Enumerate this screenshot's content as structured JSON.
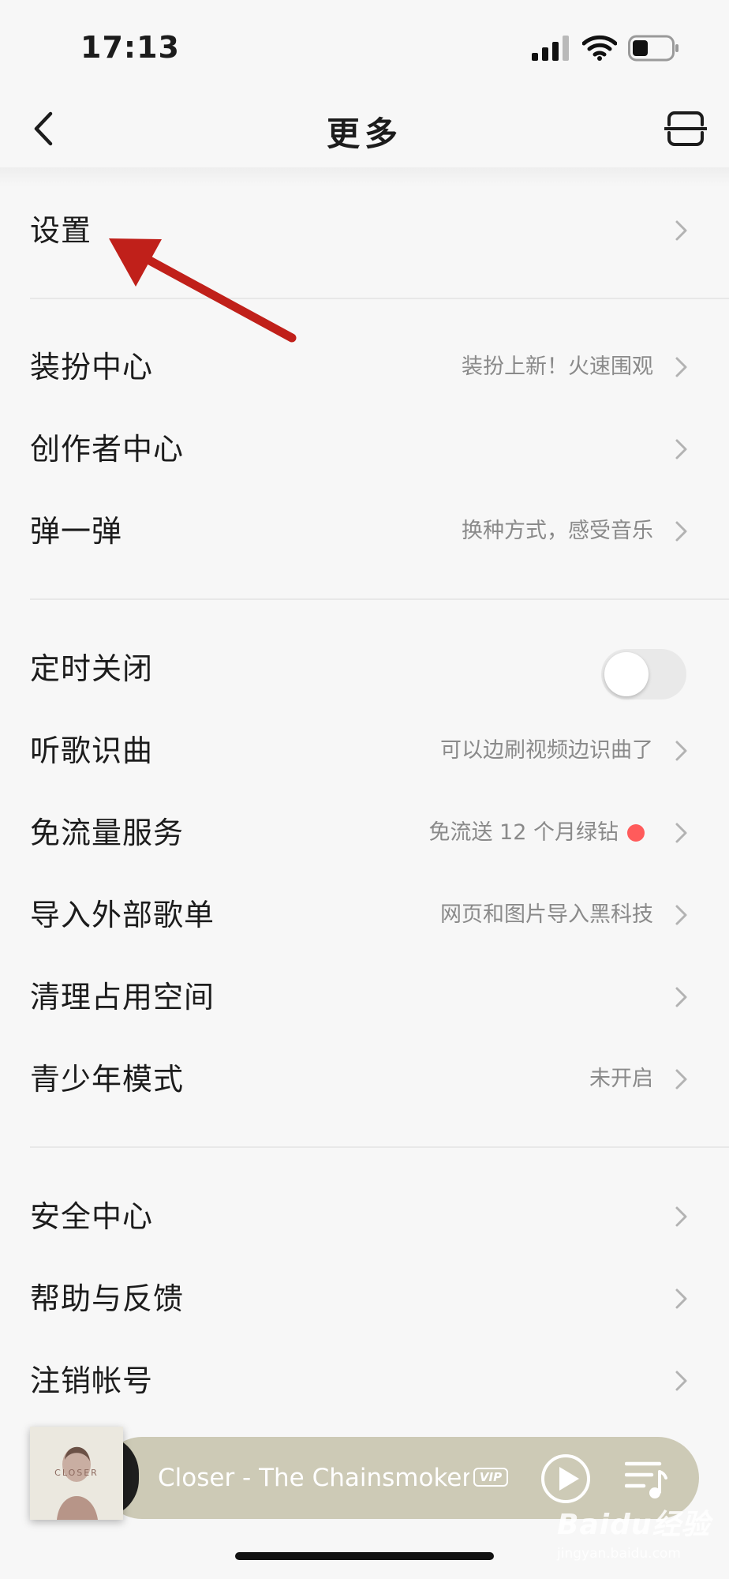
{
  "status_bar": {
    "time": "17:13"
  },
  "header": {
    "title": "更多"
  },
  "sections": [
    {
      "items": [
        {
          "label": "设置",
          "value": ""
        }
      ]
    },
    {
      "items": [
        {
          "label": "装扮中心",
          "value": "装扮上新！火速围观"
        },
        {
          "label": "创作者中心",
          "value": ""
        },
        {
          "label": "弹一弹",
          "value": "换种方式，感受音乐"
        }
      ]
    },
    {
      "items": [
        {
          "label": "定时关闭",
          "value": "",
          "toggle_on": false
        },
        {
          "label": "听歌识曲",
          "value": "可以边刷视频边识曲了"
        },
        {
          "label": "免流量服务",
          "value": "免流送 12 个月绿钻",
          "has_red_dot": true
        },
        {
          "label": "导入外部歌单",
          "value": "网页和图片导入黑科技"
        },
        {
          "label": "清理占用空间",
          "value": ""
        },
        {
          "label": "青少年模式",
          "value": "未开启"
        }
      ]
    },
    {
      "items": [
        {
          "label": "安全中心",
          "value": ""
        },
        {
          "label": "帮助与反馈",
          "value": ""
        },
        {
          "label": "注销帐号",
          "value": ""
        }
      ]
    }
  ],
  "player": {
    "song": "Closer - The Chainsmokers",
    "badge": "VIP",
    "cover_text": "CLOSER"
  },
  "watermark": {
    "main": "Baidu经验",
    "sub": "jingyan.baidu.com"
  },
  "colors": {
    "background": "#f7f7f7",
    "player_bg": "#cdcab6",
    "annotation_arrow": "#c0201a",
    "red_dot": "#ff5b5b"
  }
}
